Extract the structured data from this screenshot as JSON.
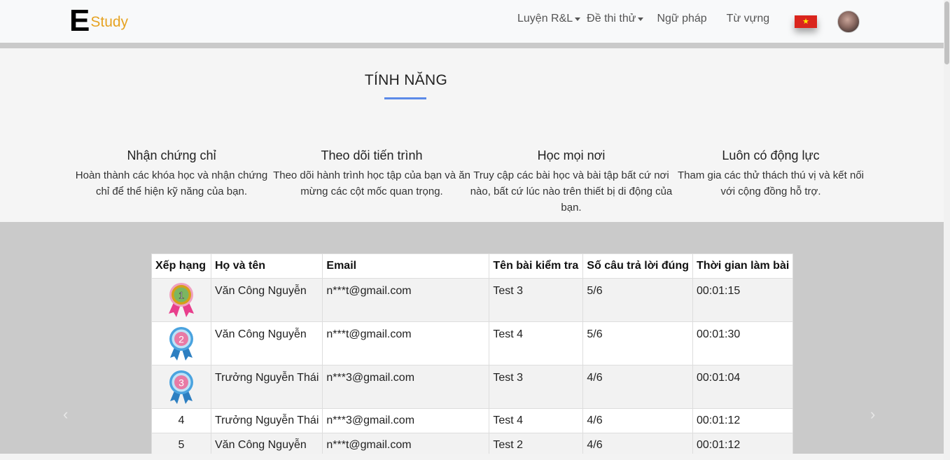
{
  "navbar": {
    "logo_letter": "E",
    "logo_text": "Study",
    "items": [
      {
        "label": "Luyện R&L",
        "dropdown": true
      },
      {
        "label": "Đề thi thử",
        "dropdown": true
      },
      {
        "label": "Ngữ pháp",
        "dropdown": false
      },
      {
        "label": "Từ vựng",
        "dropdown": false
      }
    ],
    "flag_star": "★"
  },
  "features": {
    "title": "TÍNH NĂNG",
    "items": [
      {
        "title": "Nhận chứng chỉ",
        "desc": "Hoàn thành các khóa học và nhận chứng chỉ để thể hiện kỹ năng của bạn."
      },
      {
        "title": "Theo dõi tiến trình",
        "desc": "Theo dõi hành trình học tập của bạn và ăn mừng các cột mốc quan trọng."
      },
      {
        "title": "Học mọi nơi",
        "desc": "Truy cập các bài học và bài tập bất cứ nơi nào, bất cứ lúc nào trên thiết bị di động của bạn."
      },
      {
        "title": "Luôn có động lực",
        "desc": "Tham gia các thử thách thú vị và kết nối với cộng đồng hỗ trợ."
      }
    ]
  },
  "leaderboard": {
    "headers": [
      "Xếp hạng",
      "Họ và tên",
      "Email",
      "Tên bài kiểm tra",
      "Số câu trả lời đúng",
      "Thời gian làm bài"
    ],
    "rows": [
      {
        "rank": "1",
        "name": "Văn Công Nguyễn",
        "email": "n***t@gmail.com",
        "test": "Test 3",
        "correct": "5/6",
        "time": "00:01:15"
      },
      {
        "rank": "2",
        "name": "Văn Công Nguyễn",
        "email": "n***t@gmail.com",
        "test": "Test 4",
        "correct": "5/6",
        "time": "00:01:30"
      },
      {
        "rank": "3",
        "name": "Trưởng Nguyễn Thái",
        "email": "n***3@gmail.com",
        "test": "Test 3",
        "correct": "4/6",
        "time": "00:01:04"
      },
      {
        "rank": "4",
        "name": "Trưởng Nguyễn Thái",
        "email": "n***3@gmail.com",
        "test": "Test 4",
        "correct": "4/6",
        "time": "00:01:12"
      },
      {
        "rank": "5",
        "name": "Văn Công Nguyễn",
        "email": "n***t@gmail.com",
        "test": "Test 2",
        "correct": "4/6",
        "time": "00:01:12"
      }
    ],
    "prev_arrow": "‹",
    "next_arrow": "›"
  },
  "colors": {
    "logo_accent": "#e6a323",
    "title_underline": "#5b8ae8",
    "flag_red": "#da251d",
    "flag_star": "#ffeb00",
    "board_bg": "#cacaca"
  }
}
